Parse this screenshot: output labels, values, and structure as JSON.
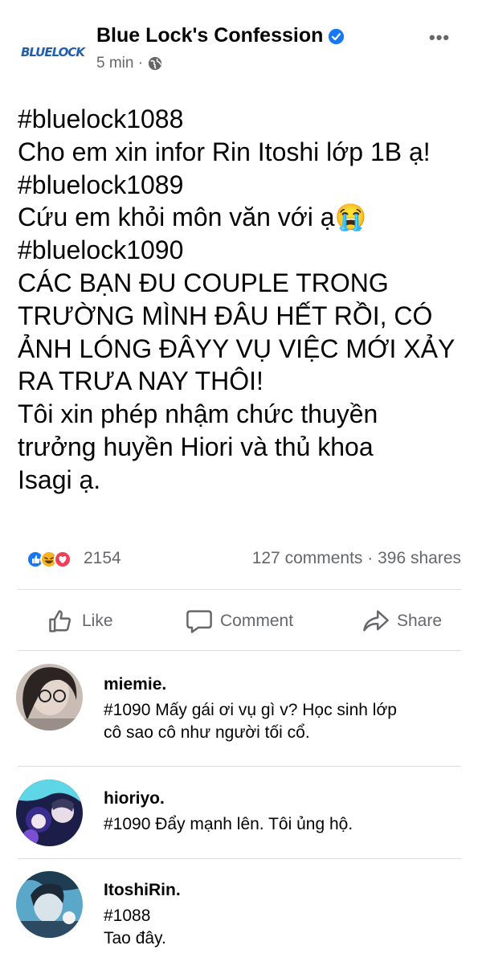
{
  "post": {
    "page_name": "Blue Lock's Confession",
    "logo_text": "BLUELOCK",
    "time": "5 min ·",
    "body_lines": [
      "#bluelock1088",
      "Cho em xin infor Rin Itoshi lớp 1B ạ!",
      "#bluelock1089",
      "Cứu em khỏi môn văn với ạ😭",
      "#bluelock1090",
      "CÁC BẠN ĐU COUPLE TRONG",
      "TRƯỜNG MÌNH ĐÂU HẾT RỒI, CÓ",
      "ẢNH LÓNG ĐÂYY VỤ VIỆC MỚI XẢY",
      "RA TRƯA NAY THÔI!",
      "Tôi xin phép nhậm chức thuyền",
      "trưởng huyền Hiori và thủ khoa",
      "Isagi ạ."
    ]
  },
  "stats": {
    "reaction_count": "2154",
    "comments_shares": "127 comments · 396 shares"
  },
  "actions": {
    "like": "Like",
    "comment": "Comment",
    "share": "Share"
  },
  "comments": [
    {
      "name": "miemie.",
      "lines": [
        "#1090 Mấy gái ơi vụ gì v? Học sinh lớp",
        "cô sao cô như người tối cổ."
      ]
    },
    {
      "name": "hioriyo.",
      "lines": [
        "#1090 Đẩy mạnh lên. Tôi ủng hộ."
      ]
    },
    {
      "name": "ItoshiRin.",
      "lines": [
        "#1088",
        "Tao đây."
      ]
    }
  ],
  "colors": {
    "accent": "#1877f2",
    "secondary_text": "#65676b",
    "primary_text": "#050505",
    "divider": "#dadde1",
    "love": "#f33e58",
    "haha": "#f7b125"
  },
  "icons": {
    "verified": "verified-badge-icon",
    "globe": "globe-icon",
    "more": "more-options-icon",
    "like": "thumbs-up-icon",
    "comment": "speech-bubble-icon",
    "share": "share-arrow-icon",
    "reactions": [
      "like-reaction-icon",
      "haha-reaction-icon",
      "love-reaction-icon"
    ]
  }
}
